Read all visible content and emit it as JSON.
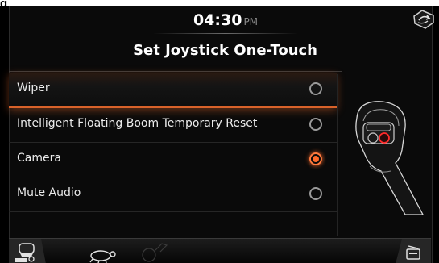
{
  "corner_caption": "g",
  "header": {
    "time": "04:30",
    "ampm": "PM"
  },
  "title": "Set Joystick One-Touch",
  "options": [
    {
      "label": "Wiper",
      "selected": false,
      "highlighted": true
    },
    {
      "label": "Intelligent Floating Boom Temporary Reset",
      "selected": false,
      "highlighted": false
    },
    {
      "label": "Camera",
      "selected": true,
      "highlighted": false
    },
    {
      "label": "Mute Audio",
      "selected": false,
      "highlighted": false
    }
  ],
  "icons": {
    "corner": "undo-arrow-icon",
    "joystick": "joystick-illustration",
    "auto": "engine-auto-icon",
    "turtle": "turtle-speed-icon",
    "hare": "hare-speed-icon",
    "radio": "radio-icon"
  },
  "colors": {
    "accent": "#ff6a2a",
    "background": "#0a0a0a",
    "text": "#ececec"
  }
}
